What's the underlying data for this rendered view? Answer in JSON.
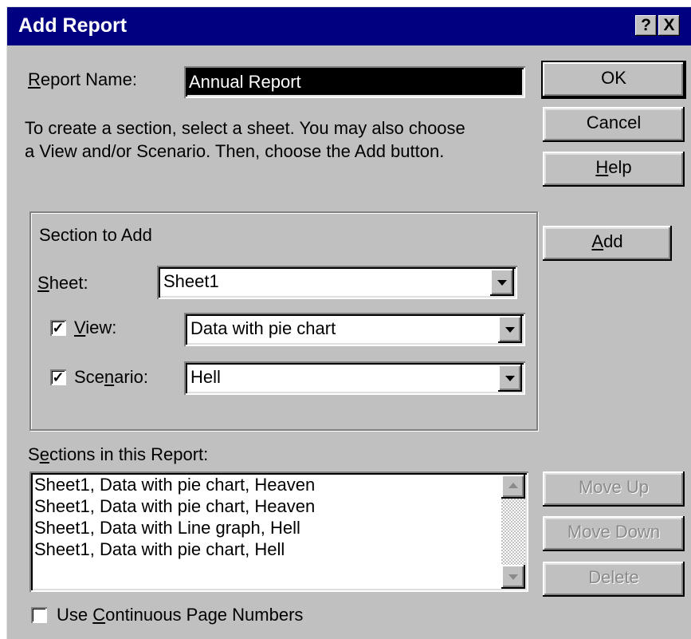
{
  "window": {
    "title": "Add Report",
    "help_button": "?",
    "close_button": "X"
  },
  "report_name": {
    "label_pre": "",
    "label_key": "R",
    "label_post": "eport Name:",
    "value": "Annual Report"
  },
  "instructions": {
    "line1": "To create a section, select a sheet.  You may also choose",
    "line2": "a View and/or Scenario.  Then, choose the Add button."
  },
  "buttons": {
    "ok": "OK",
    "cancel": "Cancel",
    "help_key": "H",
    "help_rest": "elp",
    "add_key": "A",
    "add_rest": "dd",
    "move_up": "Move Up",
    "move_down": "Move Down",
    "delete": "Delete"
  },
  "section": {
    "group_label": "Section to Add",
    "sheet_label_key": "S",
    "sheet_label_rest": "heet:",
    "sheet_value": "Sheet1",
    "view_checked": true,
    "view_label_key": "V",
    "view_label_rest": "iew:",
    "view_value": "Data with pie chart",
    "scenario_checked": true,
    "scenario_label_pre": "Sce",
    "scenario_label_key": "n",
    "scenario_label_post": "ario:",
    "scenario_value": "Hell"
  },
  "sections_list": {
    "label_pre": "S",
    "label_key": "e",
    "label_post": "ctions in this Report:",
    "items": [
      "Sheet1, Data with pie chart, Heaven",
      "Sheet1, Data with pie chart, Heaven",
      "Sheet1, Data with Line graph, Hell",
      "Sheet1, Data with pie chart, Hell"
    ]
  },
  "continuous_pages": {
    "checked": false,
    "label_pre": "Use ",
    "label_key": "C",
    "label_post": "ontinuous Page Numbers"
  }
}
